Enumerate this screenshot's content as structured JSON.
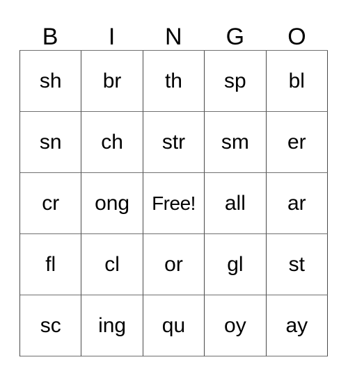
{
  "card": {
    "title": "BINGO",
    "header_letters": [
      "B",
      "I",
      "N",
      "G",
      "O"
    ],
    "free_space_label": "Free!",
    "grid_columns": 5,
    "grid_rows": 5,
    "text_color": "#000000",
    "background_color": "#ffffff",
    "border_color": "#4a4a4a",
    "rows": [
      [
        "sh",
        "br",
        "th",
        "sp",
        "bl"
      ],
      [
        "sn",
        "ch",
        "str",
        "sm",
        "er"
      ],
      [
        "cr",
        "ong",
        "Free!",
        "all",
        "ar"
      ],
      [
        "fl",
        "cl",
        "or",
        "gl",
        "st"
      ],
      [
        "sc",
        "ing",
        "qu",
        "oy",
        "ay"
      ]
    ]
  }
}
